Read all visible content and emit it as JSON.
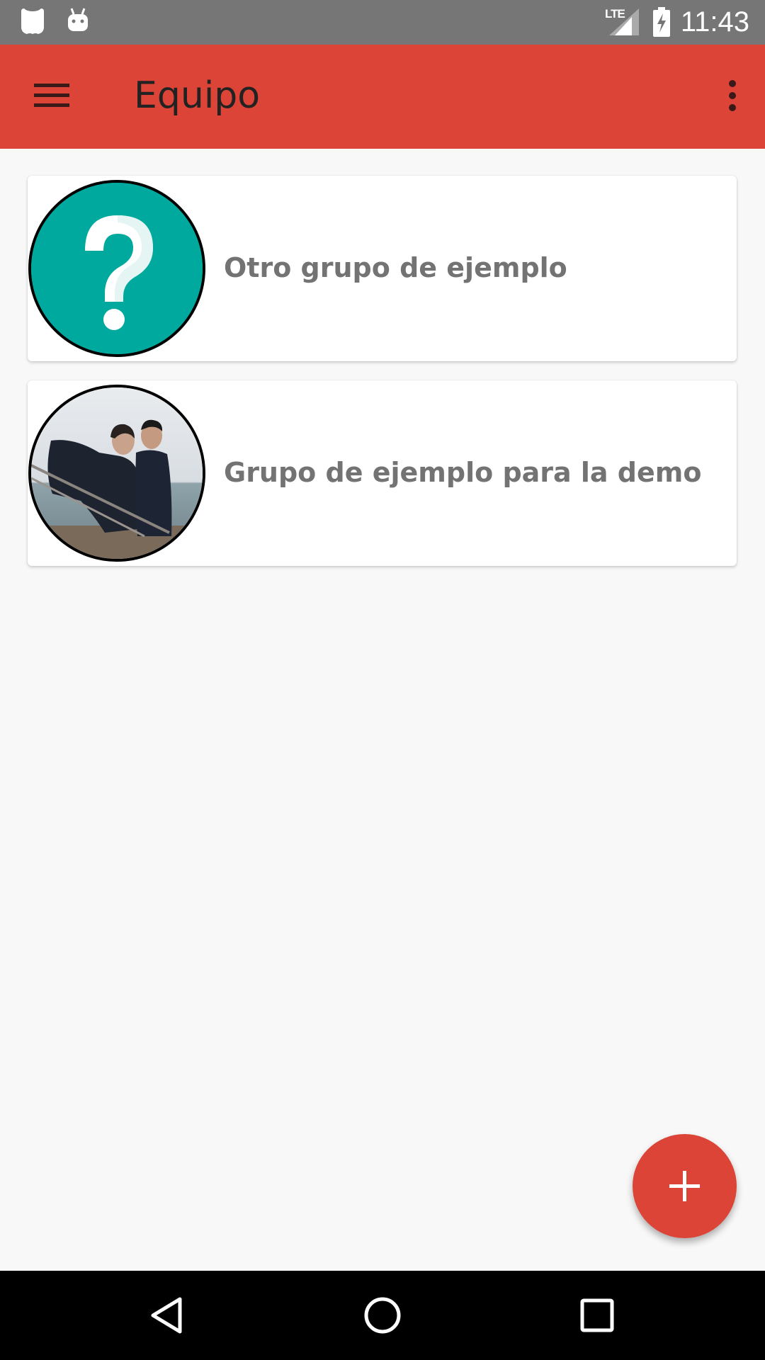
{
  "status_bar": {
    "time": "11:43",
    "network": "LTE",
    "left_icons": [
      "shield-icon",
      "android-icon"
    ],
    "right_icons": [
      "signal-icon",
      "battery-charging-icon"
    ]
  },
  "app_bar": {
    "title": "Equipo",
    "menu_icon": "hamburger-menu-icon",
    "overflow_icon": "more-vert-icon",
    "color": "#db4437"
  },
  "groups": [
    {
      "name": "Otro grupo de ejemplo",
      "avatar": "question-mark-avatar",
      "avatar_color": "#00a99d"
    },
    {
      "name": "Grupo de ejemplo para la demo",
      "avatar": "photo-avatar"
    }
  ],
  "fab": {
    "icon": "plus-icon",
    "color": "#db4437"
  },
  "nav_bar": {
    "buttons": [
      "back-icon",
      "home-icon",
      "recents-icon"
    ]
  }
}
